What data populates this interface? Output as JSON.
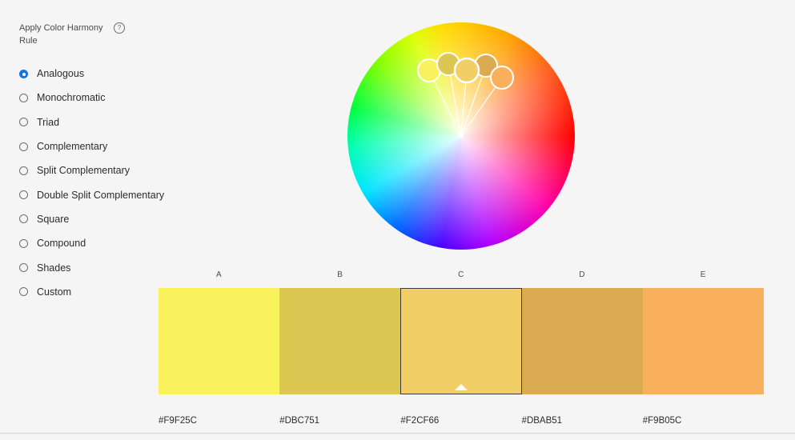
{
  "harmony": {
    "title": "Apply Color Harmony Rule",
    "help_icon": "?",
    "options": [
      {
        "label": "Analogous",
        "checked": true
      },
      {
        "label": "Monochromatic",
        "checked": false
      },
      {
        "label": "Triad",
        "checked": false
      },
      {
        "label": "Complementary",
        "checked": false
      },
      {
        "label": "Split Complementary",
        "checked": false
      },
      {
        "label": "Double Split Complementary",
        "checked": false
      },
      {
        "label": "Square",
        "checked": false
      },
      {
        "label": "Compound",
        "checked": false
      },
      {
        "label": "Shades",
        "checked": false
      },
      {
        "label": "Custom",
        "checked": false
      }
    ]
  },
  "swatches": [
    {
      "label": "A",
      "color": "#F9F25C",
      "hex": "#F9F25C",
      "selected": false
    },
    {
      "label": "B",
      "color": "#DBC751",
      "hex": "#DBC751",
      "selected": false
    },
    {
      "label": "C",
      "color": "#F2CF66",
      "hex": "#F2CF66",
      "selected": true
    },
    {
      "label": "D",
      "color": "#DBAB51",
      "hex": "#DBAB51",
      "selected": false
    },
    {
      "label": "E",
      "color": "#F9B05C",
      "hex": "#F9B05C",
      "selected": false
    }
  ],
  "accent_color": "#1473E6"
}
